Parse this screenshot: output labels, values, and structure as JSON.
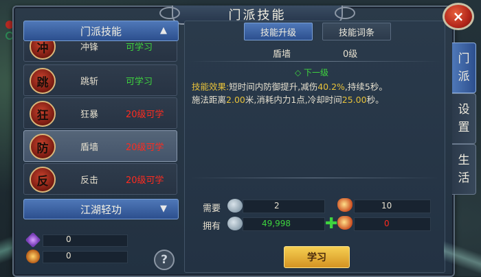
{
  "window": {
    "title": "门派技能",
    "close_glyph": "×"
  },
  "left": {
    "category_header": "门派技能",
    "category_header_arrow": "▲",
    "skills": [
      {
        "icon_char": "冲",
        "name": "冲锋",
        "status": "可学习",
        "status_color": "green"
      },
      {
        "icon_char": "跳",
        "name": "跳斩",
        "status": "可学习",
        "status_color": "green"
      },
      {
        "icon_char": "狂",
        "name": "狂暴",
        "status": "20级可学",
        "status_color": "red"
      },
      {
        "icon_char": "防",
        "name": "盾墙",
        "status": "20级可学",
        "status_color": "red",
        "selected": true
      },
      {
        "icon_char": "反",
        "name": "反击",
        "status": "20级可学",
        "status_color": "red"
      }
    ],
    "second_category": "江湖轻功",
    "second_category_arrow": "▼",
    "resources": [
      {
        "icon": "crystal-icon",
        "value": "0"
      },
      {
        "icon": "gold-ingot-icon",
        "value": "0"
      }
    ],
    "help_glyph": "?"
  },
  "right": {
    "tabs": [
      {
        "label": "技能升级",
        "active": true
      },
      {
        "label": "技能词条",
        "active": false
      }
    ],
    "skill_name": "盾墙",
    "skill_level": "0级",
    "next_level_label": "◇ 下一级",
    "effect": {
      "label": "技能效果:",
      "line1_a": "短时间内防御提升,减伤",
      "line1_b": "40.2%",
      "line1_c": ",持续5秒。",
      "line2_a": "施法距离",
      "line2_b": "2.00",
      "line2_c": "米,消耗内力1点,冷却时间",
      "line2_d": "25.00",
      "line2_e": "秒。"
    },
    "need": {
      "label": "需要",
      "coin_value": "2",
      "ingot_value": "10"
    },
    "own": {
      "label": "拥有",
      "coin_value": "49,998",
      "plus_glyph": "✚",
      "ingot_value": "0"
    },
    "learn_button": "学习"
  },
  "side_tabs": [
    {
      "chars": [
        "门",
        "派"
      ],
      "active": true
    },
    {
      "chars": [
        "设",
        "置"
      ],
      "active": false
    },
    {
      "chars": [
        "生",
        "活"
      ],
      "active": false
    }
  ],
  "colors": {
    "available": "#3ed43e",
    "locked": "#ff2b1f",
    "highlight": "#e8c23a",
    "accent_blue": "#4f78b8"
  }
}
